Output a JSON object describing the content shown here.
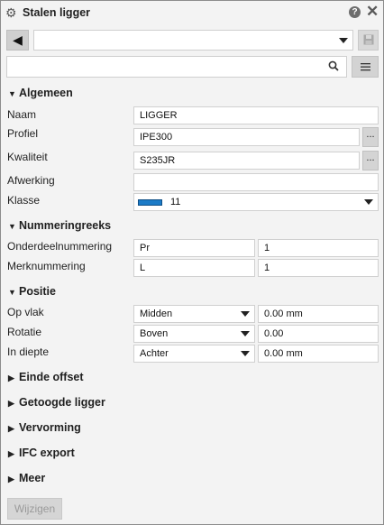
{
  "window": {
    "title": "Stalen ligger",
    "help_icon": "question-icon",
    "close_icon": "close-icon",
    "gear_icon": "gear-icon"
  },
  "toolbar": {
    "back_glyph": "◀",
    "preset_value": "",
    "save_glyph": "💾"
  },
  "search": {
    "value": "",
    "menu_glyph": "☰"
  },
  "sections": {
    "algemeen": {
      "title": "Algemeen",
      "naam": {
        "label": "Naam",
        "value": "LIGGER"
      },
      "profiel": {
        "label": "Profiel",
        "value": "IPE300",
        "button": "..."
      },
      "kwaliteit": {
        "label": "Kwaliteit",
        "value": "S235JR",
        "button": "..."
      },
      "afwerking": {
        "label": "Afwerking",
        "value": ""
      },
      "klasse": {
        "label": "Klasse",
        "value": "11",
        "swatch_color": "#1c7bc7"
      }
    },
    "nummeringreeks": {
      "title": "Nummeringreeks",
      "onderdeel": {
        "label": "Onderdeelnummering",
        "prefix": "Pr",
        "start": "1"
      },
      "merk": {
        "label": "Merknummering",
        "prefix": "L",
        "start": "1"
      }
    },
    "positie": {
      "title": "Positie",
      "op_vlak": {
        "label": "Op vlak",
        "option": "Midden",
        "value": "0.00 mm"
      },
      "rotatie": {
        "label": "Rotatie",
        "option": "Boven",
        "value": "0.00"
      },
      "in_diepte": {
        "label": "In diepte",
        "option": "Achter",
        "value": "0.00 mm"
      }
    },
    "collapsed": [
      "Einde offset",
      "Getoogde ligger",
      "Vervorming",
      "IFC export",
      "Meer"
    ]
  },
  "footer": {
    "modify_label": "Wijzigen"
  }
}
